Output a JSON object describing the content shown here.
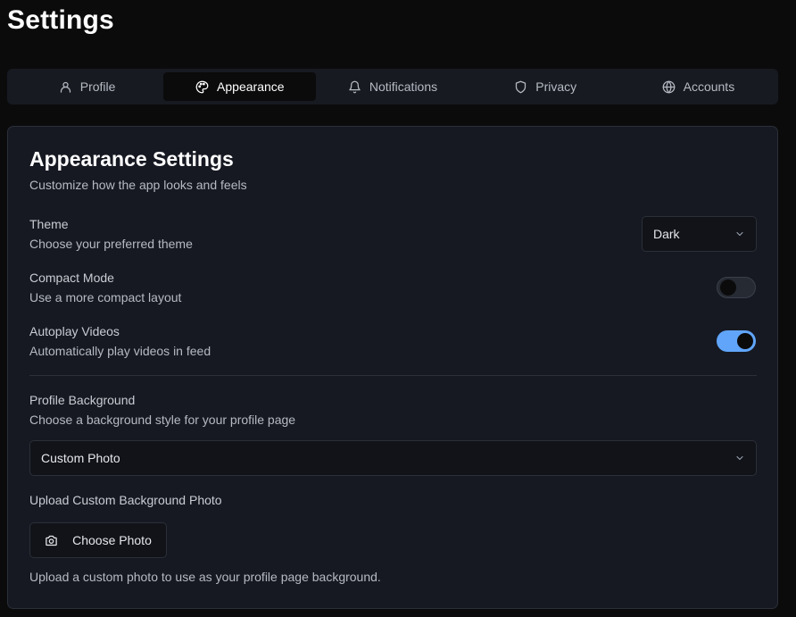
{
  "page": {
    "title": "Settings"
  },
  "tabs": [
    {
      "label": "Profile",
      "icon": "user-icon"
    },
    {
      "label": "Appearance",
      "icon": "palette-icon",
      "active": true
    },
    {
      "label": "Notifications",
      "icon": "bell-icon"
    },
    {
      "label": "Privacy",
      "icon": "shield-icon"
    },
    {
      "label": "Accounts",
      "icon": "globe-icon"
    }
  ],
  "card": {
    "title": "Appearance Settings",
    "subtitle": "Customize how the app looks and feels"
  },
  "theme": {
    "label": "Theme",
    "description": "Choose your preferred theme",
    "value": "Dark"
  },
  "compact_mode": {
    "label": "Compact Mode",
    "description": "Use a more compact layout",
    "enabled": false
  },
  "autoplay": {
    "label": "Autoplay Videos",
    "description": "Automatically play videos in feed",
    "enabled": true
  },
  "profile_background": {
    "label": "Profile Background",
    "description": "Choose a background style for your profile page",
    "value": "Custom Photo"
  },
  "upload": {
    "label": "Upload Custom Background Photo",
    "button_label": "Choose Photo",
    "button_icon": "camera-icon",
    "help": "Upload a custom photo to use as your profile page background."
  },
  "colors": {
    "background": "#0b0b0c",
    "card": "#161922",
    "border": "#2b2f38",
    "accent": "#60a5fa"
  }
}
